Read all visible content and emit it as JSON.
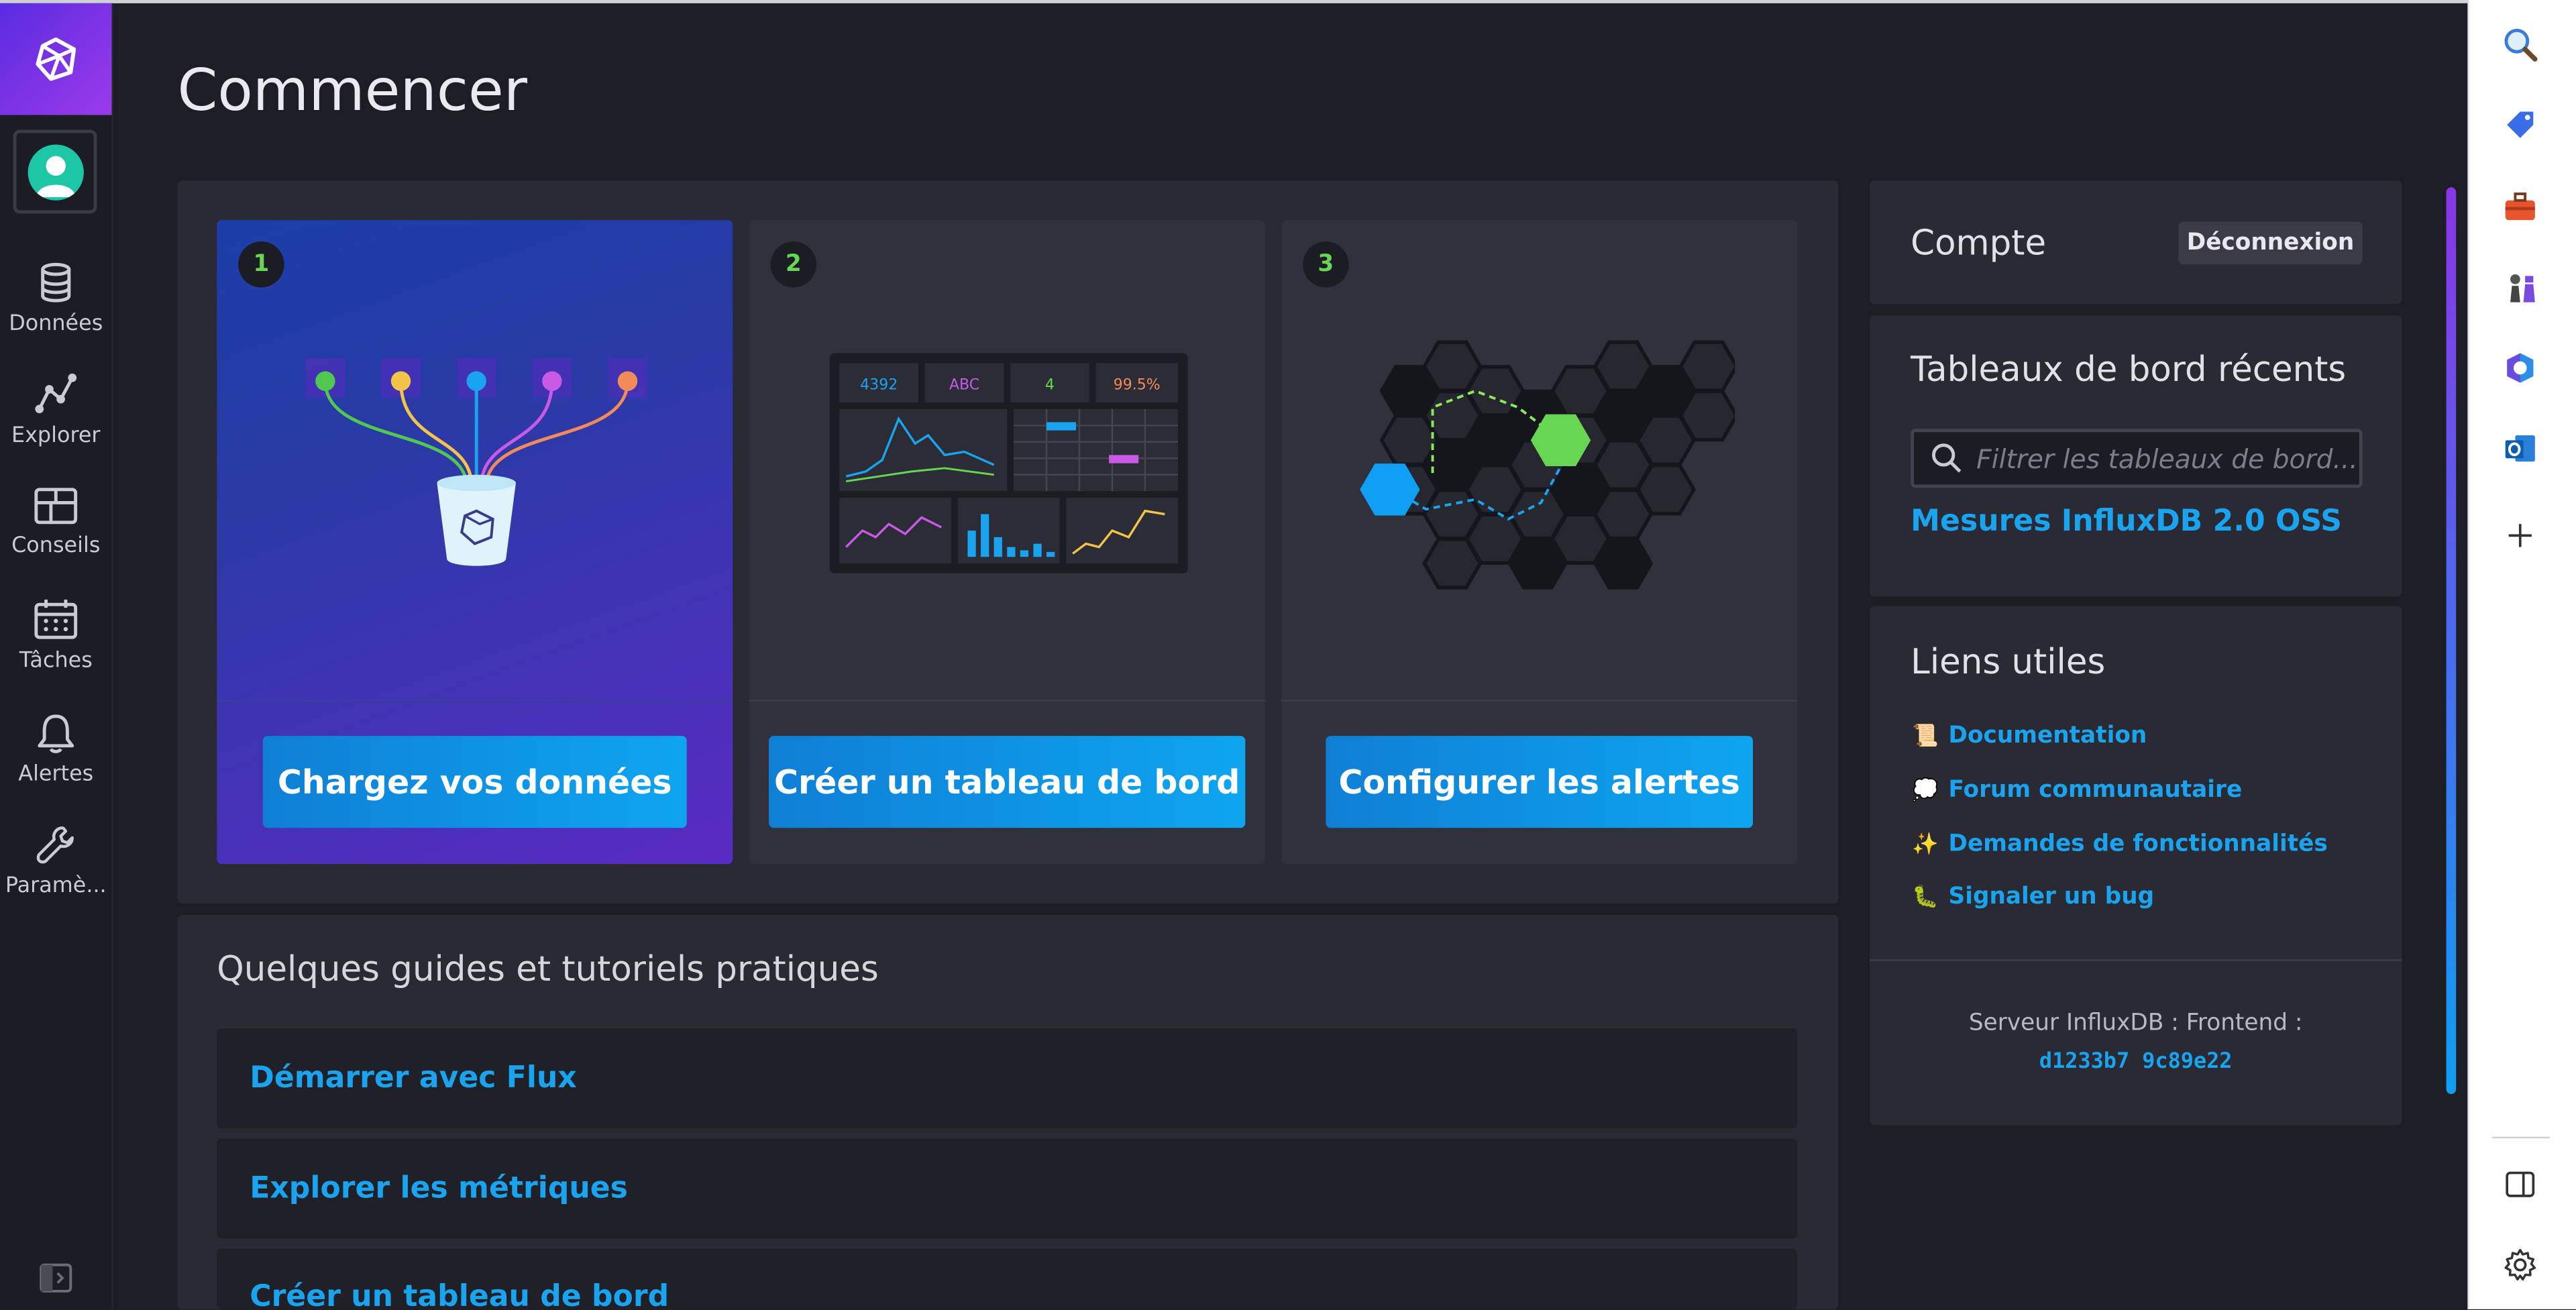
{
  "nav": {
    "items": [
      {
        "label": "Données",
        "icon": "database-icon"
      },
      {
        "label": "Explorer",
        "icon": "graph-icon"
      },
      {
        "label": "Conseils",
        "icon": "dashboards-icon"
      },
      {
        "label": "Tâches",
        "icon": "calendar-icon"
      },
      {
        "label": "Alertes",
        "icon": "bell-icon"
      },
      {
        "label": "Paramè...",
        "icon": "wrench-icon"
      }
    ]
  },
  "page": {
    "title": "Commencer"
  },
  "steps": [
    {
      "number": "1",
      "button": "Chargez vos données"
    },
    {
      "number": "2",
      "button": "Créer un tableau de bord"
    },
    {
      "number": "3",
      "button": "Configurer les alertes"
    }
  ],
  "illustration2": {
    "stats": [
      "4392",
      "ABC",
      "4",
      "99.5%"
    ]
  },
  "guides": {
    "title": "Quelques guides et tutoriels pratiques",
    "items": [
      "Démarrer avec Flux",
      "Explorer les métriques",
      "Créer un tableau de bord"
    ]
  },
  "account": {
    "title": "Compte",
    "logout": "Déconnexion"
  },
  "recent": {
    "title": "Tableaux de bord récents",
    "search_placeholder": "Filtrer les tableaux de bord...",
    "items": [
      "Mesures InfluxDB 2.0 OSS"
    ]
  },
  "links": {
    "title": "Liens utiles",
    "items": [
      {
        "emoji": "📜",
        "label": "Documentation"
      },
      {
        "emoji": "💭",
        "label": "Forum communautaire"
      },
      {
        "emoji": "✨",
        "label": "Demandes de fonctionnalités"
      },
      {
        "emoji": "🐛",
        "label": "Signaler un bug"
      }
    ],
    "server_label": "Serveur InfluxDB : Frontend :",
    "server_hash": "d1233b7 9c89e22"
  },
  "colors": {
    "accent": "#1aa4f0",
    "step_number": "#66d653",
    "background": "#1c1d25"
  }
}
